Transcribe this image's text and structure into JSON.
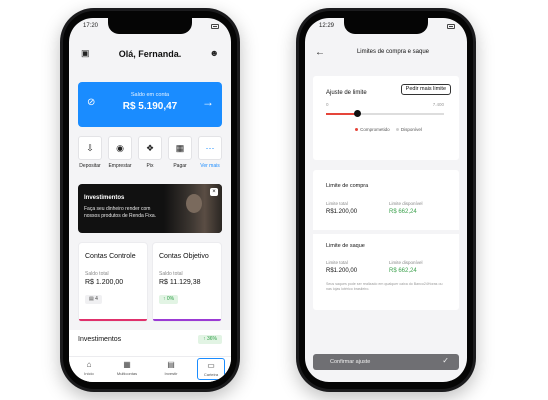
{
  "phone1": {
    "status_time": "17:20",
    "greeting": "Olá, Fernanda.",
    "icons": {
      "chat": "chat-add-icon",
      "profile": "user-icon"
    },
    "balance": {
      "label": "Saldo em conta",
      "value": "R$ 5.190,47",
      "hide_icon": "eye-off-icon",
      "arrow_icon": "arrow-right-icon"
    },
    "actions": [
      {
        "label": "Depositar",
        "icon": "deposit-icon"
      },
      {
        "label": "Emprestar",
        "icon": "lend-icon"
      },
      {
        "label": "Pix",
        "icon": "pix-icon"
      },
      {
        "label": "Pagar",
        "icon": "barcode-icon"
      },
      {
        "label": "Ver mais",
        "icon": "more-icon"
      }
    ],
    "promo": {
      "title": "Investimentos",
      "text": "Faça seu dinheiro render com nossos produtos de Renda Fixa.",
      "close": "×"
    },
    "cards": [
      {
        "title": "Contas Controle",
        "label": "Saldo total",
        "value": "R$ 1.200,00",
        "chip": "4",
        "chip_icon": "card-icon",
        "accent": "#e0306b"
      },
      {
        "title": "Contas Objetivo",
        "label": "Saldo total",
        "value": "R$ 11.129,38",
        "chip": "0%",
        "chip_icon": "arrow-up-icon",
        "accent": "#9b3ad4"
      }
    ],
    "investments": {
      "title": "Investimentos",
      "pct": "36%"
    },
    "tabs": [
      {
        "label": "Início",
        "icon": "home-icon"
      },
      {
        "label": "Multicontas",
        "icon": "grid-icon"
      },
      {
        "label": "Investir",
        "icon": "chart-icon"
      },
      {
        "label": "Carteira",
        "icon": "wallet-icon"
      }
    ]
  },
  "phone2": {
    "status_time": "12:29",
    "title": "Limites de compra e saque",
    "adjust": {
      "title": "Ajuste de limite",
      "button": "Pedir mais limite",
      "min": "0",
      "max": "7.400",
      "committed_fraction": 0.26,
      "legend": [
        {
          "label": "Comprometido",
          "color": "#e5453a"
        },
        {
          "label": "Disponível",
          "color": "#cfcfcf"
        }
      ]
    },
    "purchase": {
      "title": "Limite de compra",
      "total_label": "Limite total",
      "total": "R$1.200,00",
      "avail_label": "Limite disponível",
      "available": "R$ 662,24"
    },
    "withdraw": {
      "title": "Limite de saque",
      "total_label": "Limite total",
      "total": "R$1.200,00",
      "avail_label": "Limite disponível",
      "available": "R$ 662,24",
      "note": "Seus saques pode ser realizado em qualquer caixa do Banco24Horas ou nas lojas lotérico brasileiro."
    },
    "confirm": "Confirmar ajuste"
  }
}
